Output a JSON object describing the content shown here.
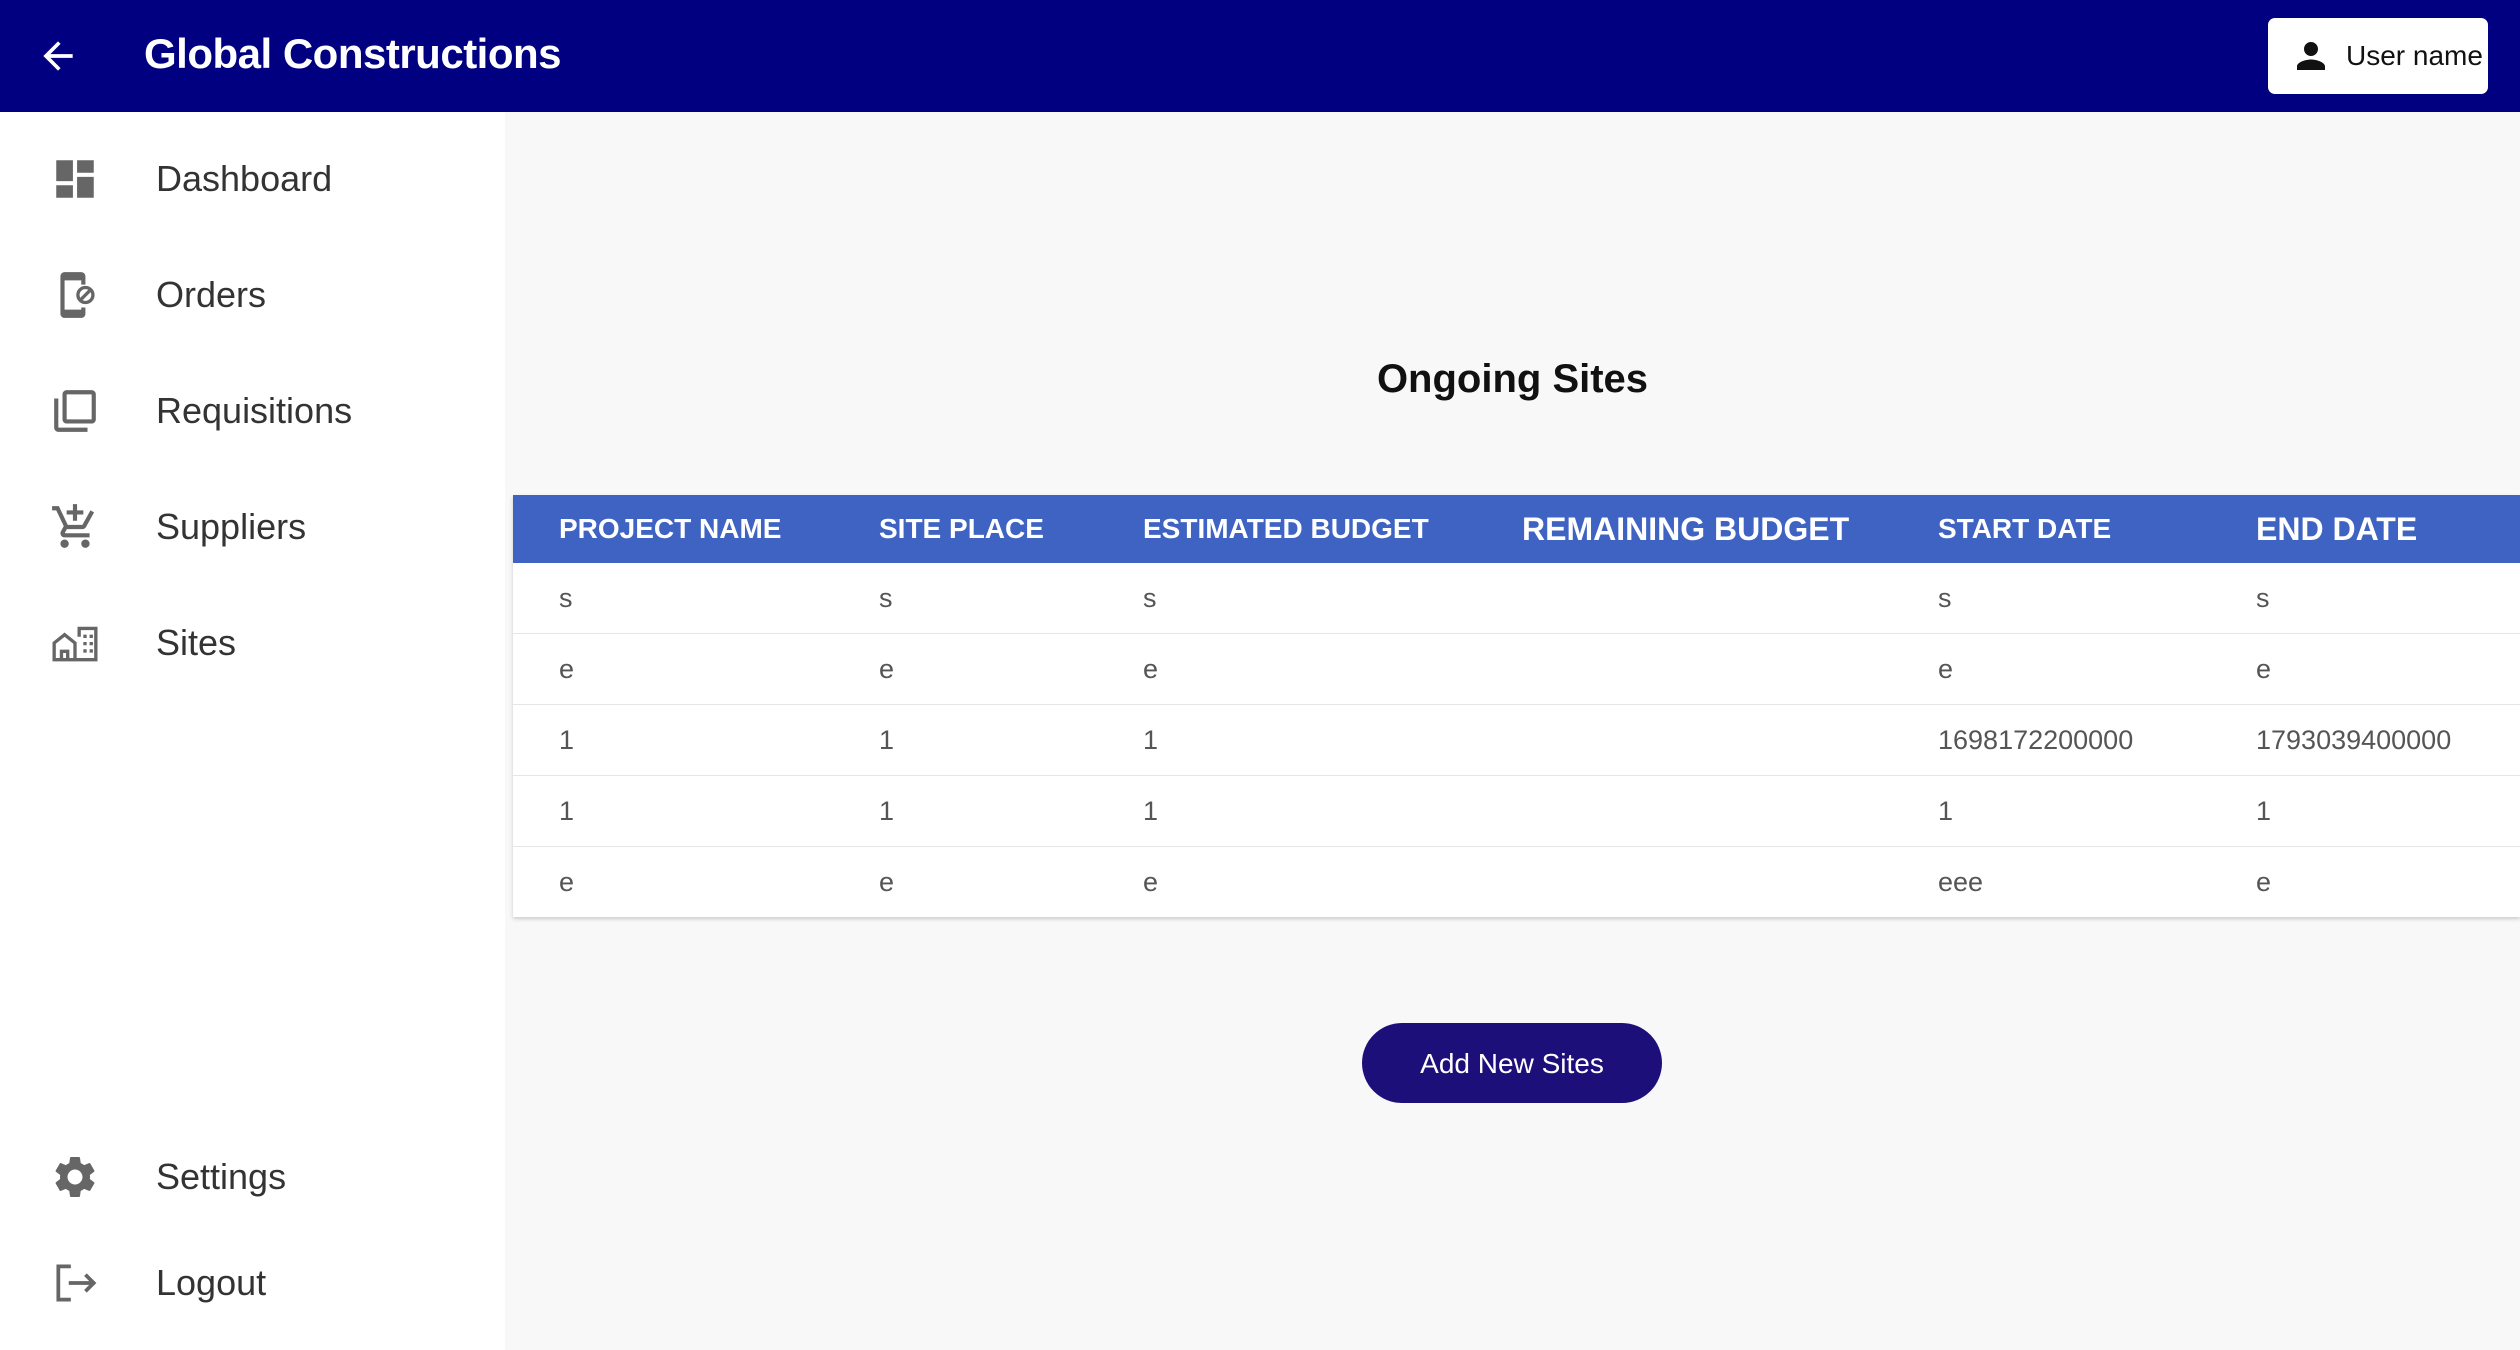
{
  "app": {
    "title": "Global Constructions"
  },
  "header": {
    "user_label": "User name"
  },
  "sidebar": {
    "items": [
      {
        "label": "Dashboard",
        "icon": "dashboard-icon"
      },
      {
        "label": "Orders",
        "icon": "orders-icon"
      },
      {
        "label": "Requisitions",
        "icon": "requisitions-icon"
      },
      {
        "label": "Suppliers",
        "icon": "cart-icon"
      },
      {
        "label": "Sites",
        "icon": "sites-icon"
      }
    ],
    "bottom_items": [
      {
        "label": "Settings",
        "icon": "gear-icon"
      },
      {
        "label": "Logout",
        "icon": "logout-icon"
      }
    ]
  },
  "main": {
    "heading": "Ongoing Sites",
    "table": {
      "columns": [
        "PROJECT NAME",
        "SITE PLACE",
        "ESTIMATED BUDGET",
        "REMAINING BUDGET",
        "START DATE",
        "END DATE"
      ],
      "rows": [
        [
          "s",
          "s",
          "s",
          "",
          "s",
          "s"
        ],
        [
          "e",
          "e",
          "e",
          "",
          "e",
          "e"
        ],
        [
          "1",
          "1",
          "1",
          "",
          "1698172200000",
          "1793039400000"
        ],
        [
          "1",
          "1",
          "1",
          "",
          "1",
          "1"
        ],
        [
          "e",
          "e",
          "e",
          "",
          "eee",
          "e"
        ]
      ]
    },
    "add_button": "Add New Sites"
  },
  "colors": {
    "appbar": "#000080",
    "table_header": "#3f63c2",
    "add_button": "#1c0f7a"
  }
}
